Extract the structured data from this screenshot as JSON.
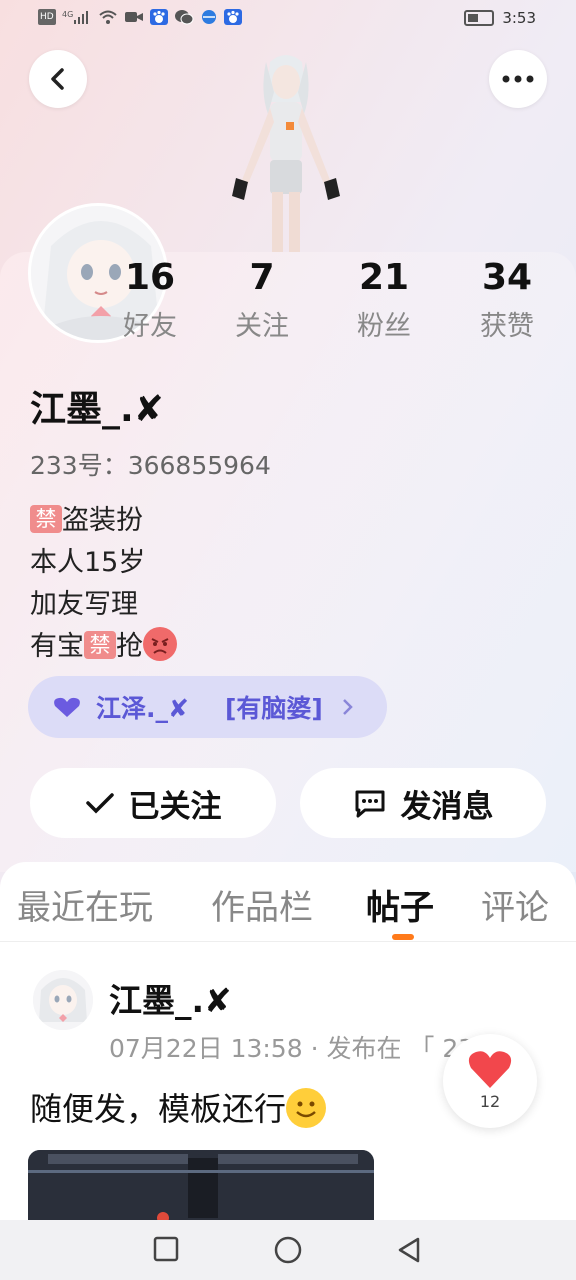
{
  "status_bar": {
    "left_icons": [
      "hd-icon",
      "signal-icon",
      "wifi-icon",
      "video-icon",
      "baidu-icon",
      "wechat-icon",
      "browser-icon",
      "baidu-icon"
    ],
    "time": "3:53"
  },
  "profile": {
    "stats": [
      {
        "num": "16",
        "label": "好友"
      },
      {
        "num": "7",
        "label": "关注"
      },
      {
        "num": "21",
        "label": "粉丝"
      },
      {
        "num": "34",
        "label": "获赞"
      }
    ],
    "name": "江墨_.✘",
    "uid": "233号：366855964",
    "bio": {
      "line1_badge": "禁",
      "line1_text": "盗装扮",
      "line2": "本人15岁",
      "line3": "加友写理",
      "line4_a": "有宝",
      "line4_badge": "禁",
      "line4_b": "抢"
    },
    "cp": {
      "name": "江泽._✘",
      "relation": "[有脑婆]"
    },
    "follow_label": "已关注",
    "message_label": "发消息"
  },
  "tabs": [
    "最近在玩",
    "作品栏",
    "帖子",
    "评论"
  ],
  "active_tab": "帖子",
  "post": {
    "author": "江墨_.✘",
    "time": "07月22日 13:58 · 发布在 「 233...",
    "text": "随便发，模板还行",
    "likes": "12"
  },
  "colors": {
    "accent": "#ff7a1a",
    "cp_text": "#5b58d6",
    "cp_bg": "#dcdcf7",
    "ban": "#f08c8c"
  }
}
